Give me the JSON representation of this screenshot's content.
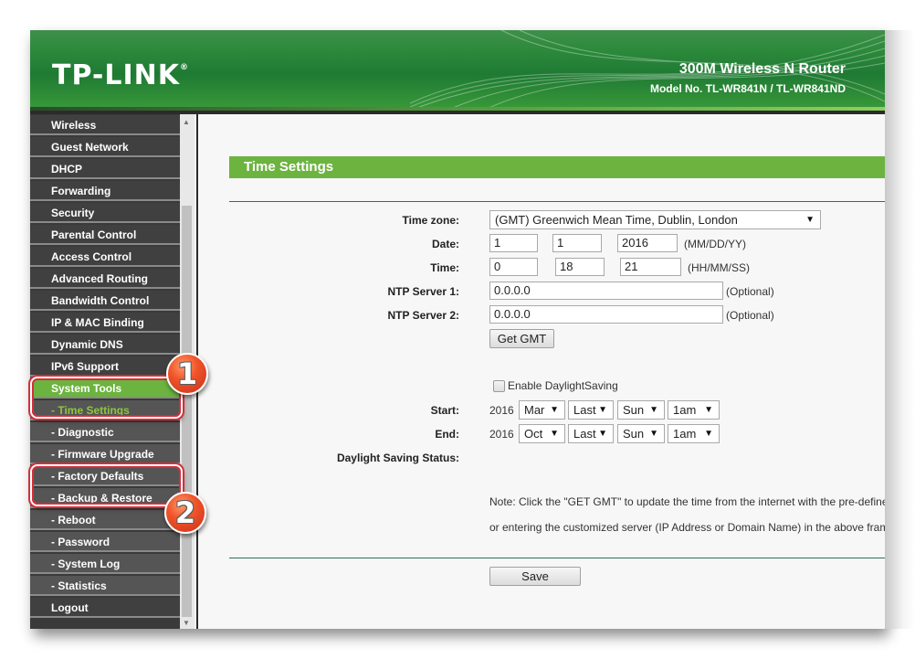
{
  "header": {
    "logo": "TP-LINK",
    "logo_mark": "®",
    "product": "300M Wireless N Router",
    "model": "Model No. TL-WR841N / TL-WR841ND"
  },
  "sidebar": {
    "items": [
      {
        "label": "Wireless",
        "type": "main"
      },
      {
        "label": "Guest Network",
        "type": "main"
      },
      {
        "label": "DHCP",
        "type": "main"
      },
      {
        "label": "Forwarding",
        "type": "main"
      },
      {
        "label": "Security",
        "type": "main"
      },
      {
        "label": "Parental Control",
        "type": "main"
      },
      {
        "label": "Access Control",
        "type": "main"
      },
      {
        "label": "Advanced Routing",
        "type": "main"
      },
      {
        "label": "Bandwidth Control",
        "type": "main"
      },
      {
        "label": "IP & MAC Binding",
        "type": "main"
      },
      {
        "label": "Dynamic DNS",
        "type": "main"
      },
      {
        "label": "IPv6 Support",
        "type": "main"
      },
      {
        "label": "System Tools",
        "type": "active"
      },
      {
        "label": "- Time Settings",
        "type": "sub-active"
      },
      {
        "label": "- Diagnostic",
        "type": "sub"
      },
      {
        "label": "- Firmware Upgrade",
        "type": "sub"
      },
      {
        "label": "- Factory Defaults",
        "type": "sub"
      },
      {
        "label": "- Backup & Restore",
        "type": "sub"
      },
      {
        "label": "- Reboot",
        "type": "sub"
      },
      {
        "label": "- Password",
        "type": "sub"
      },
      {
        "label": "- System Log",
        "type": "sub"
      },
      {
        "label": "- Statistics",
        "type": "sub"
      },
      {
        "label": "Logout",
        "type": "main"
      }
    ],
    "scroll_up": "▲",
    "scroll_down": "▼"
  },
  "annotations": {
    "badge1": "1",
    "badge2": "2"
  },
  "form": {
    "title": "Time Settings",
    "timezone_label": "Time zone:",
    "timezone_value": "(GMT) Greenwich Mean Time, Dublin, London",
    "date_label": "Date:",
    "date_month": "1",
    "date_day": "1",
    "date_year": "2016",
    "date_hint": "(MM/DD/YY)",
    "time_label": "Time:",
    "time_hour": "0",
    "time_min": "18",
    "time_sec": "21",
    "time_hint": "(HH/MM/SS)",
    "ntp1_label": "NTP Server 1:",
    "ntp1_value": "0.0.0.0",
    "ntp2_label": "NTP Server 2:",
    "ntp2_value": "0.0.0.0",
    "optional": "(Optional)",
    "get_gmt": "Get GMT",
    "dst_label": "Enable DaylightSaving",
    "dst_checked": false,
    "start_label": "Start:",
    "start_year": "2016",
    "start_month": "Mar",
    "start_week": "Last",
    "start_day": "Sun",
    "start_hour": "1am",
    "end_label": "End:",
    "end_year": "2016",
    "end_month": "Oct",
    "end_week": "Last",
    "end_day": "Sun",
    "end_hour": "1am",
    "dst_status_label": "Daylight Saving Status:",
    "note_line1": "Note: Click the \"GET GMT\" to update the time from the internet with the pre-defined",
    "note_line2": "or entering the customized server (IP Address or Domain Name) in the above frame",
    "save": "Save"
  },
  "icons": {
    "dropdown": "▼"
  }
}
